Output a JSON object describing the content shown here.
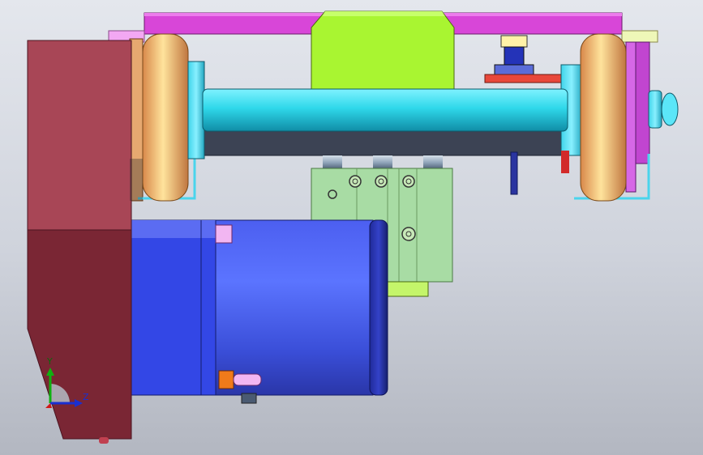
{
  "viewport": {
    "background_top": "#e4e7ed",
    "background_bottom": "#b3b7c1"
  },
  "triad": {
    "x_label": "Z",
    "y_label": "Y",
    "x_color": "#1a2fd0",
    "y_color": "#10b010"
  },
  "parts": {
    "frame_color": "#d63fd6",
    "cover_color": "#9f4754",
    "motor_color": "#3f55e6",
    "shaft_color": "#2fd6e8",
    "wheel_color": "#e7a56d",
    "bracket_color": "#aaf22d",
    "guide_color": "#a8dca0"
  }
}
